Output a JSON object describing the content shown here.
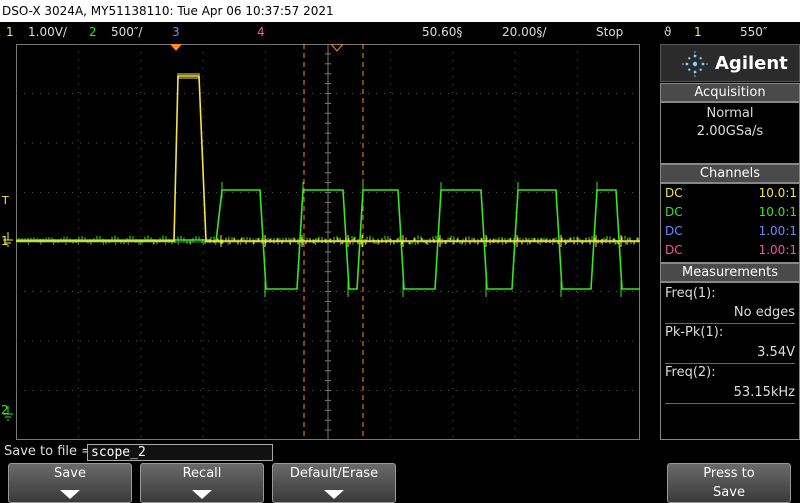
{
  "window": {
    "title": "DSO-X 3024A, MY51138110: Tue Apr 06 10:37:57 2021"
  },
  "status": {
    "ch1_num": "1",
    "ch1_scale": "1.00V/",
    "ch2_num": "2",
    "ch2_scale": "500″/",
    "ch3_num": "3",
    "ch4_num": "4",
    "delay": "50.60§",
    "timebase": "20.00§/",
    "run_state": "Stop",
    "trig_icon": "ϑ",
    "trig_src": "1",
    "trig_level": "550″"
  },
  "markers": {
    "ch1": "1",
    "ch2": "2",
    "trig": "T"
  },
  "logo": {
    "brand": "Agilent",
    "icon": "spark-burst-icon"
  },
  "acquisition": {
    "title": "Acquisition",
    "mode": "Normal",
    "rate": "2.00GSa/s"
  },
  "channels": {
    "title": "Channels",
    "rows": [
      {
        "coupling": "DC",
        "probe": "10.0:1",
        "color": "#f5e642"
      },
      {
        "coupling": "DC",
        "probe": "10.0:1",
        "color": "#39e61f"
      },
      {
        "coupling": "DC",
        "probe": "1.00:1",
        "color": "#6b8cff"
      },
      {
        "coupling": "DC",
        "probe": "1.00:1",
        "color": "#ff4da0"
      }
    ]
  },
  "measurements": {
    "title": "Measurements",
    "items": [
      {
        "label": "Freq(1):",
        "value": "No edges"
      },
      {
        "label": "Pk-Pk(1):",
        "value": "3.54V"
      },
      {
        "label": "Freq(2):",
        "value": "53.15kHz"
      }
    ]
  },
  "savefile": {
    "label": "Save to file =",
    "value": "scope_2"
  },
  "softkeys": [
    {
      "label": "Save"
    },
    {
      "label": "Recall"
    },
    {
      "label": "Default/Erase"
    },
    {
      "label": "Press to",
      "label2": "Save"
    }
  ],
  "colors": {
    "ch1": "#f5e642",
    "ch2": "#39e61f",
    "ch3": "#6b8cff",
    "ch4": "#ff4da0",
    "cursor": "#ff8c1a",
    "grid": "#666666"
  }
}
